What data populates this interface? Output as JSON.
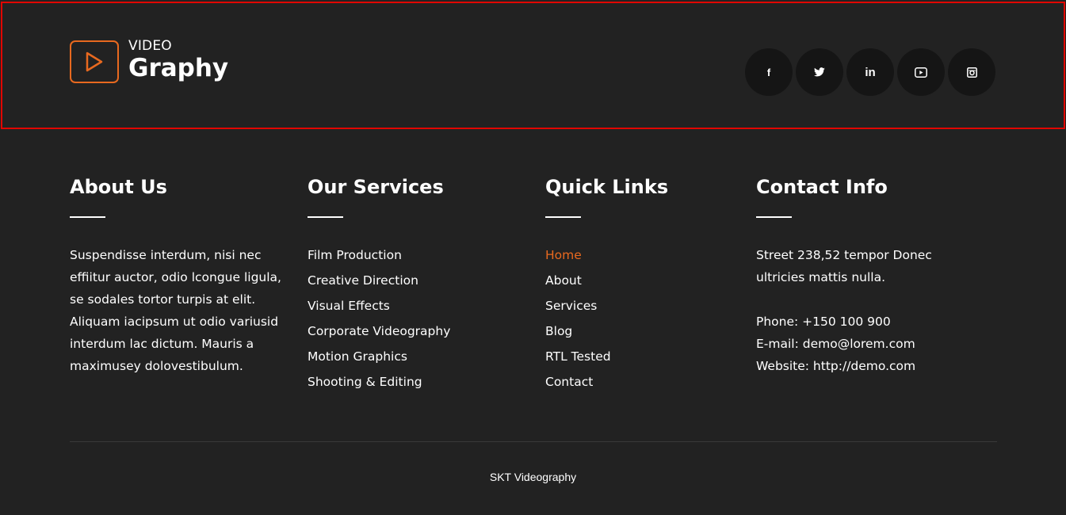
{
  "header": {
    "logo_small": "VIDEO",
    "logo_big": "Graphy",
    "social": [
      {
        "icon": "facebook-icon",
        "label": "f"
      },
      {
        "icon": "twitter-icon"
      },
      {
        "icon": "linkedin-icon",
        "label": "in"
      },
      {
        "icon": "youtube-icon"
      },
      {
        "icon": "instagram-icon"
      }
    ]
  },
  "about": {
    "title": "About Us",
    "text": "Suspendisse interdum, nisi nec effiitur auctor, odio lcongue ligula, se sodales tortor turpis at elit. Aliquam iacipsum ut odio variusid interdum lac dictum. Mauris a maximusey dolovestibulum."
  },
  "services": {
    "title": "Our Services",
    "items": [
      "Film Production",
      "Creative Direction",
      "Visual Effects",
      "Corporate Videography",
      "Motion Graphics",
      "Shooting & Editing"
    ]
  },
  "links": {
    "title": "Quick Links",
    "items": [
      "Home",
      "About",
      "Services",
      "Blog",
      "RTL Tested",
      "Contact"
    ]
  },
  "contact": {
    "title": "Contact Info",
    "address": "Street 238,52 tempor Donec ultricies mattis nulla.",
    "phone": "Phone: +150 100 900",
    "email": "E-mail: demo@lorem.com",
    "website": "Website: http://demo.com"
  },
  "footer": {
    "copyright": "SKT Videography"
  },
  "colors": {
    "background": "#222222",
    "accent": "#e8691f",
    "highlight_border": "#e10600",
    "social_bg": "#151515"
  }
}
